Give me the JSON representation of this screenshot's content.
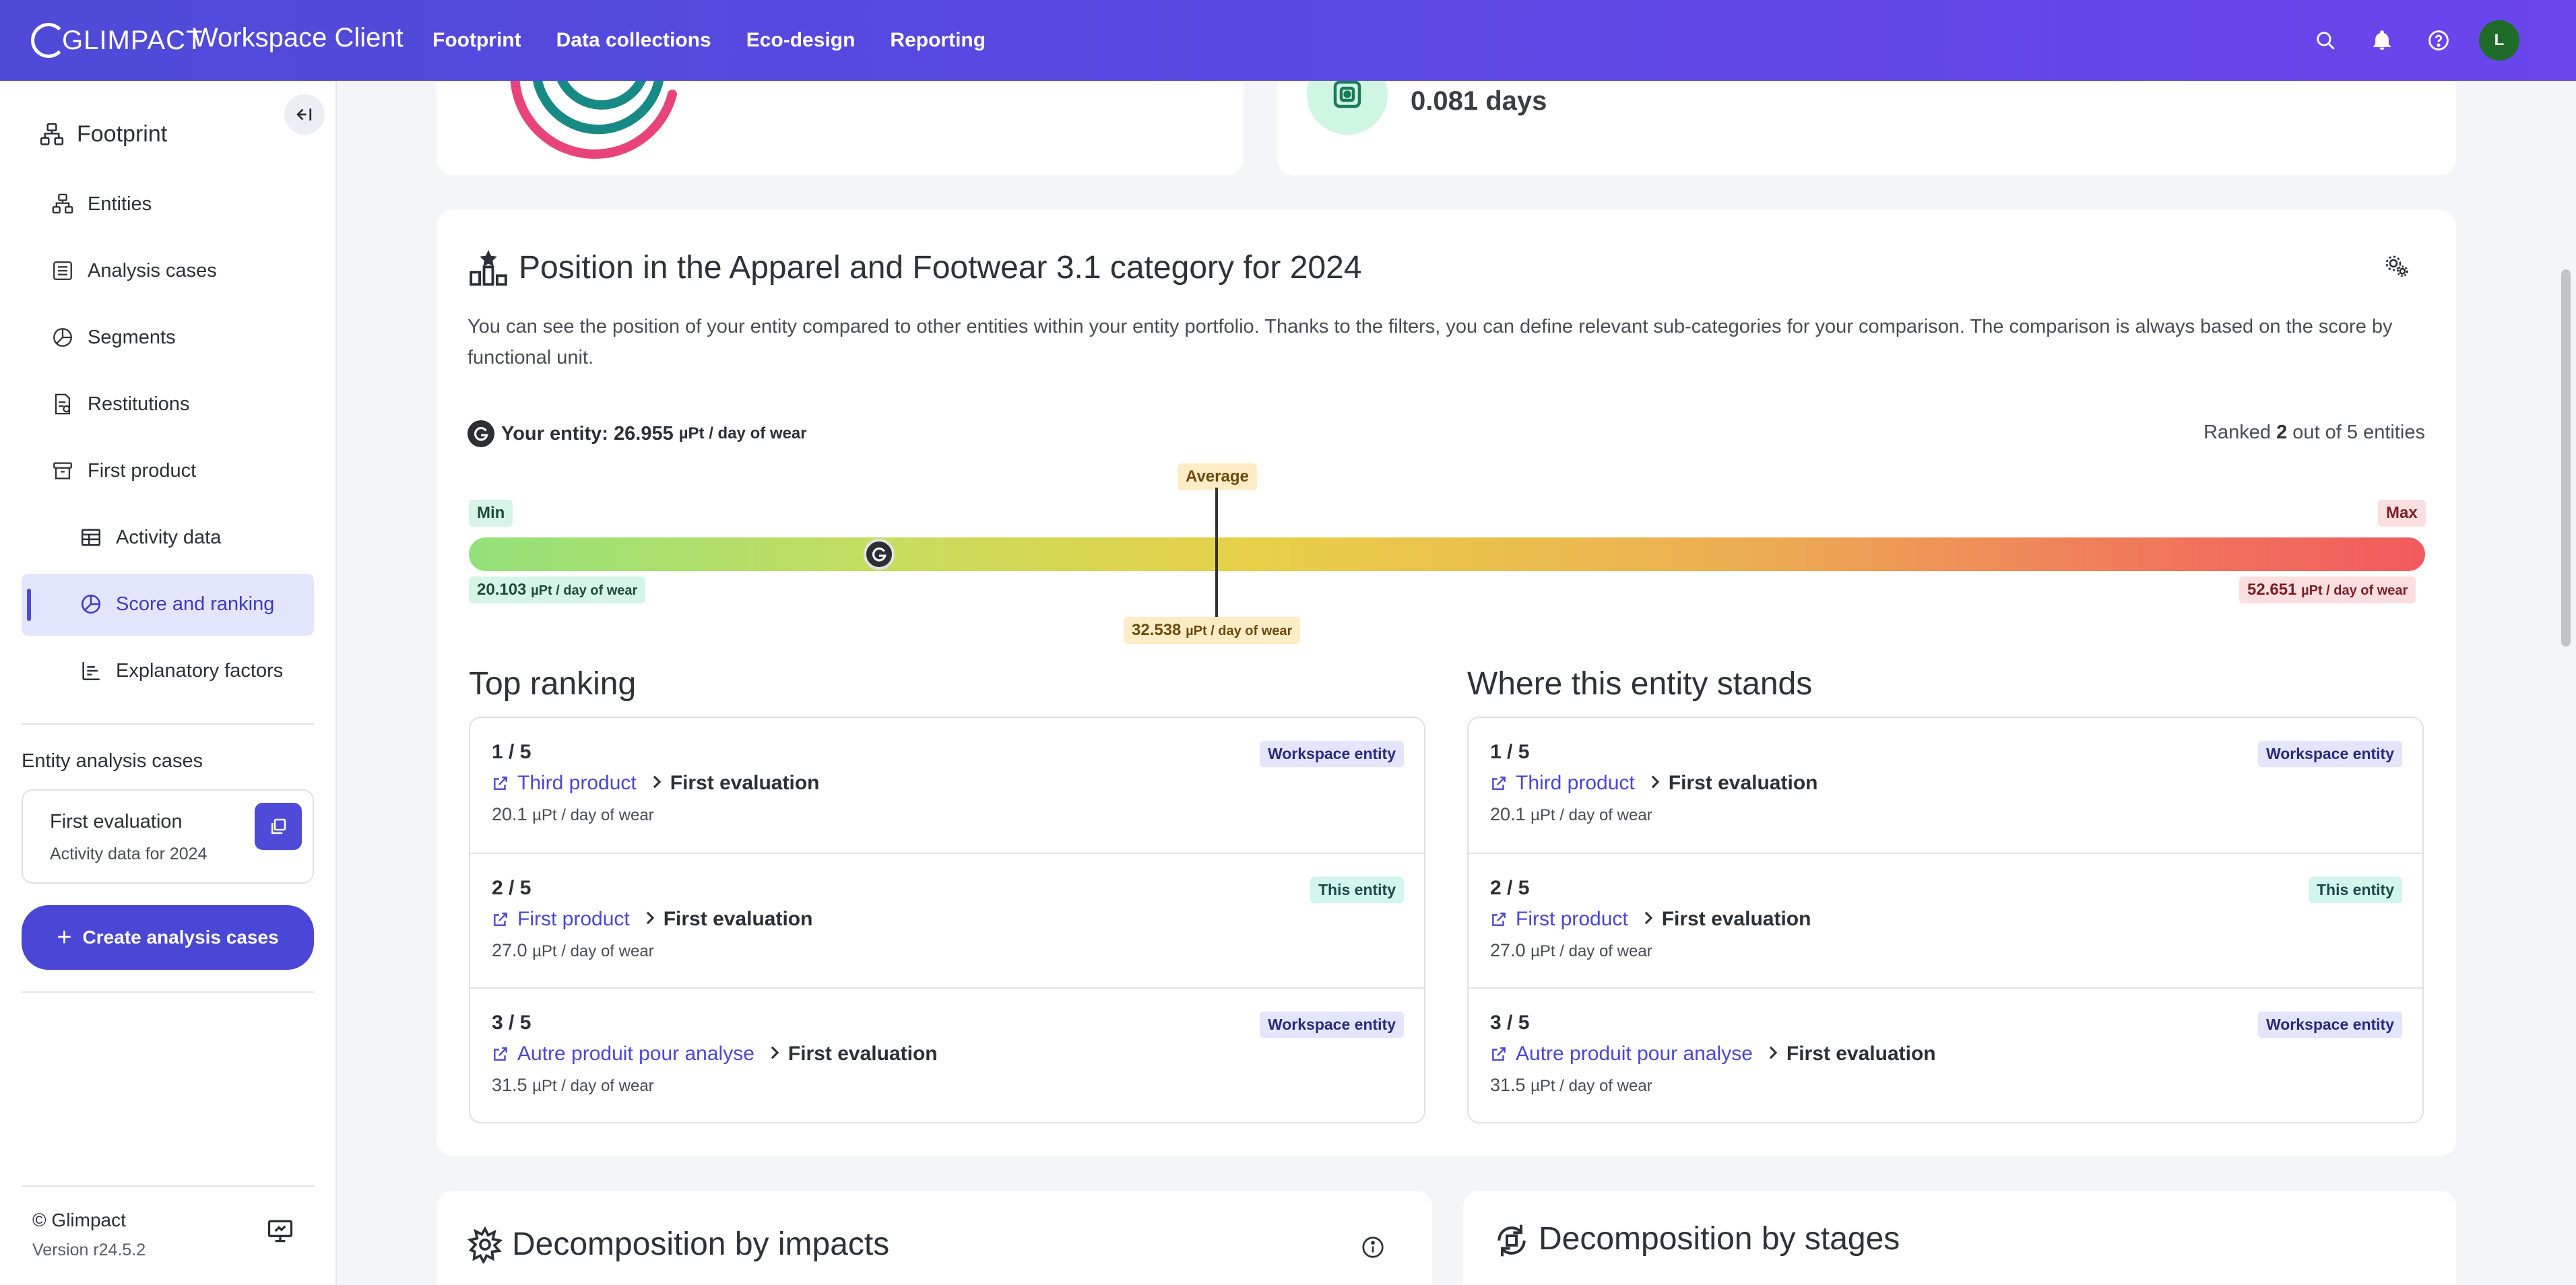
{
  "app": {
    "logo_text": "GLIMPACT",
    "title": "Workspace Client"
  },
  "nav": [
    {
      "label": "Footprint",
      "active": true
    },
    {
      "label": "Data collections",
      "active": false
    },
    {
      "label": "Eco-design",
      "active": false
    },
    {
      "label": "Reporting",
      "active": false
    }
  ],
  "user": {
    "initial": "L",
    "avatar_color": "#1f6b2a"
  },
  "sidebar": {
    "root": "Footprint",
    "items": [
      {
        "label": "Entities"
      },
      {
        "label": "Analysis cases"
      },
      {
        "label": "Segments"
      },
      {
        "label": "Restitutions"
      },
      {
        "label": "First product"
      },
      {
        "label": "Activity data"
      },
      {
        "label": "Score and ranking",
        "active": true
      },
      {
        "label": "Explanatory factors"
      }
    ],
    "analysis_heading": "Entity analysis cases",
    "case": {
      "title": "First evaluation",
      "subtitle": "Activity data for 2024"
    },
    "create_button": "Create analysis cases",
    "copyright": "© Glimpact",
    "version": "Version r24.5.2"
  },
  "top_right_card": {
    "value": "0.081 days"
  },
  "position": {
    "title": "Position in the Apparel and Footwear 3.1 category for 2024",
    "description": "You can see the position of your entity compared to other entities within your entity portfolio. Thanks to the filters, you can define relevant sub-categories for your comparison. The comparison is always based on the score by functional unit.",
    "entity_label": "Your entity: 26.955",
    "unit": "µPt / day of wear",
    "rank_prefix": "Ranked ",
    "rank_value": "2",
    "rank_suffix": " out of 5 entities",
    "min_label": "Min",
    "max_label": "Max",
    "avg_label": "Average",
    "min_value": "20.103",
    "max_value": "52.651",
    "avg_value": "32.538",
    "scale": {
      "min": 20.103,
      "max": 52.651,
      "average": 32.538,
      "entity": 26.955
    }
  },
  "top_ranking": {
    "title": "Top ranking",
    "rows": [
      {
        "pos": "1 / 5",
        "product": "Third product",
        "evaluation": "First evaluation",
        "score": "20.1",
        "unit": "µPt / day of wear",
        "badge": "Workspace entity",
        "badge_type": "ws"
      },
      {
        "pos": "2 / 5",
        "product": "First product",
        "evaluation": "First evaluation",
        "score": "27.0",
        "unit": "µPt / day of wear",
        "badge": "This entity",
        "badge_type": "this"
      },
      {
        "pos": "3 / 5",
        "product": "Autre produit pour analyse",
        "evaluation": "First evaluation",
        "score": "31.5",
        "unit": "µPt / day of wear",
        "badge": "Workspace entity",
        "badge_type": "ws"
      }
    ]
  },
  "where_stands": {
    "title": "Where this entity stands",
    "rows": [
      {
        "pos": "1 / 5",
        "product": "Third product",
        "evaluation": "First evaluation",
        "score": "20.1",
        "unit": "µPt / day of wear",
        "badge": "Workspace entity",
        "badge_type": "ws"
      },
      {
        "pos": "2 / 5",
        "product": "First product",
        "evaluation": "First evaluation",
        "score": "27.0",
        "unit": "µPt / day of wear",
        "badge": "This entity",
        "badge_type": "this"
      },
      {
        "pos": "3 / 5",
        "product": "Autre produit pour analyse",
        "evaluation": "First evaluation",
        "score": "31.5",
        "unit": "µPt / day of wear",
        "badge": "Workspace entity",
        "badge_type": "ws"
      }
    ]
  },
  "decomposition": {
    "impacts_title": "Decomposition by impacts",
    "stages_title": "Decomposition by stages"
  },
  "colors": {
    "brand": "#4f4ad8",
    "link": "#4a46d6"
  }
}
